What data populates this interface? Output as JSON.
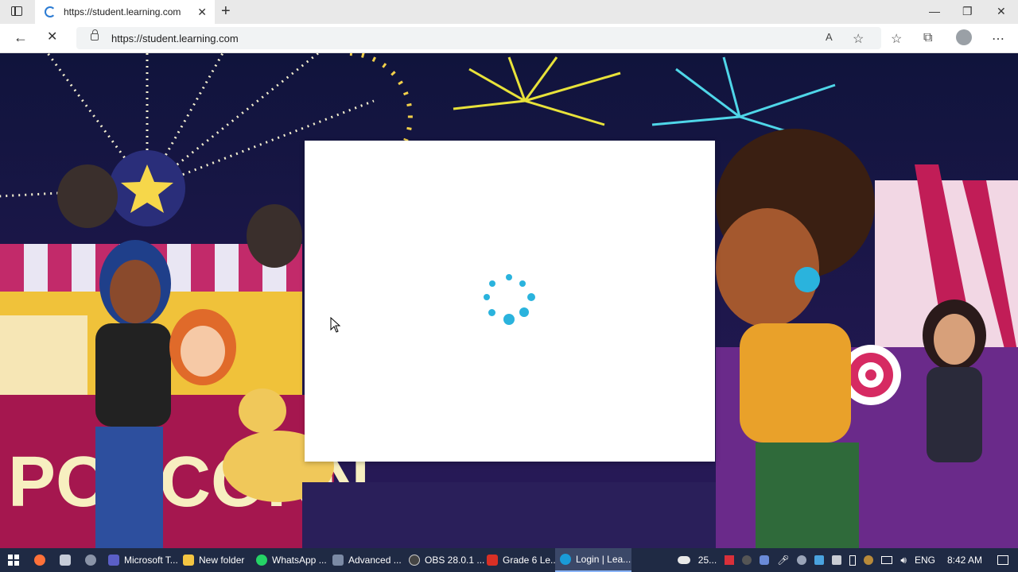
{
  "browser": {
    "tab_title": "https://student.learning.com",
    "url": "https://student.learning.com"
  },
  "taskbar": {
    "items": [
      {
        "label": "Microsoft T...",
        "color": "#5b5fc7"
      },
      {
        "label": "New folder",
        "color": "#f4c542"
      },
      {
        "label": "WhatsApp ...",
        "color": "#25d366"
      },
      {
        "label": "Advanced ...",
        "color": "#7b8aa5"
      },
      {
        "label": "OBS 28.0.1 ...",
        "color": "#444444"
      },
      {
        "label": "Grade 6 Le...",
        "color": "#d93025"
      },
      {
        "label": "Login | Lea...",
        "color": "#1a9bd7"
      }
    ],
    "weather": "25...",
    "language": "ENG",
    "time": "8:42 AM"
  },
  "colors": {
    "spinner": "#2ab3dd",
    "taskbar": "#1f2a44"
  }
}
